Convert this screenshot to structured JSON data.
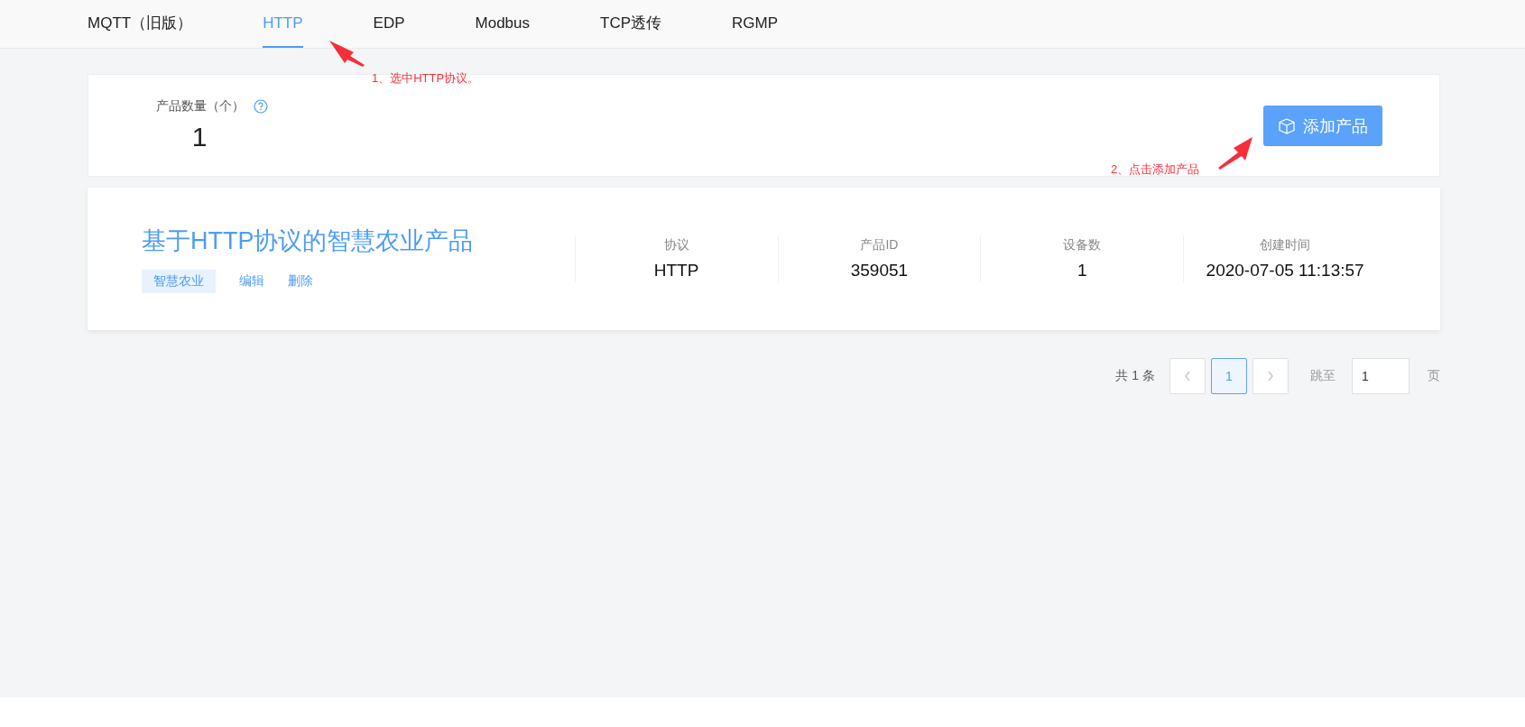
{
  "tabs": [
    {
      "label": "MQTT（旧版）",
      "selected": false
    },
    {
      "label": "HTTP",
      "selected": true
    },
    {
      "label": "EDP",
      "selected": false
    },
    {
      "label": "Modbus",
      "selected": false
    },
    {
      "label": "TCP透传",
      "selected": false
    },
    {
      "label": "RGMP",
      "selected": false
    }
  ],
  "stats": {
    "label": "产品数量（个）",
    "value": "1"
  },
  "add_button": "添加产品",
  "product": {
    "name": "基于HTTP协议的智慧农业产品",
    "tag": "智慧农业",
    "actions": [
      "编辑",
      "删除"
    ],
    "fields": [
      {
        "label": "协议",
        "value": "HTTP"
      },
      {
        "label": "产品ID",
        "value": "359051"
      },
      {
        "label": "设备数",
        "value": "1"
      },
      {
        "label": "创建时间",
        "value": "2020-07-05 11:13:57"
      }
    ]
  },
  "pagination": {
    "total": "共 1 条",
    "pages": [
      {
        "label": "1",
        "selected": true
      }
    ],
    "jump_label": "跳至",
    "jump_value": "1",
    "suffix": "页"
  },
  "annotations": [
    {
      "text": "1、选中HTTP协议。"
    },
    {
      "text": "2、点击添加产品"
    }
  ]
}
